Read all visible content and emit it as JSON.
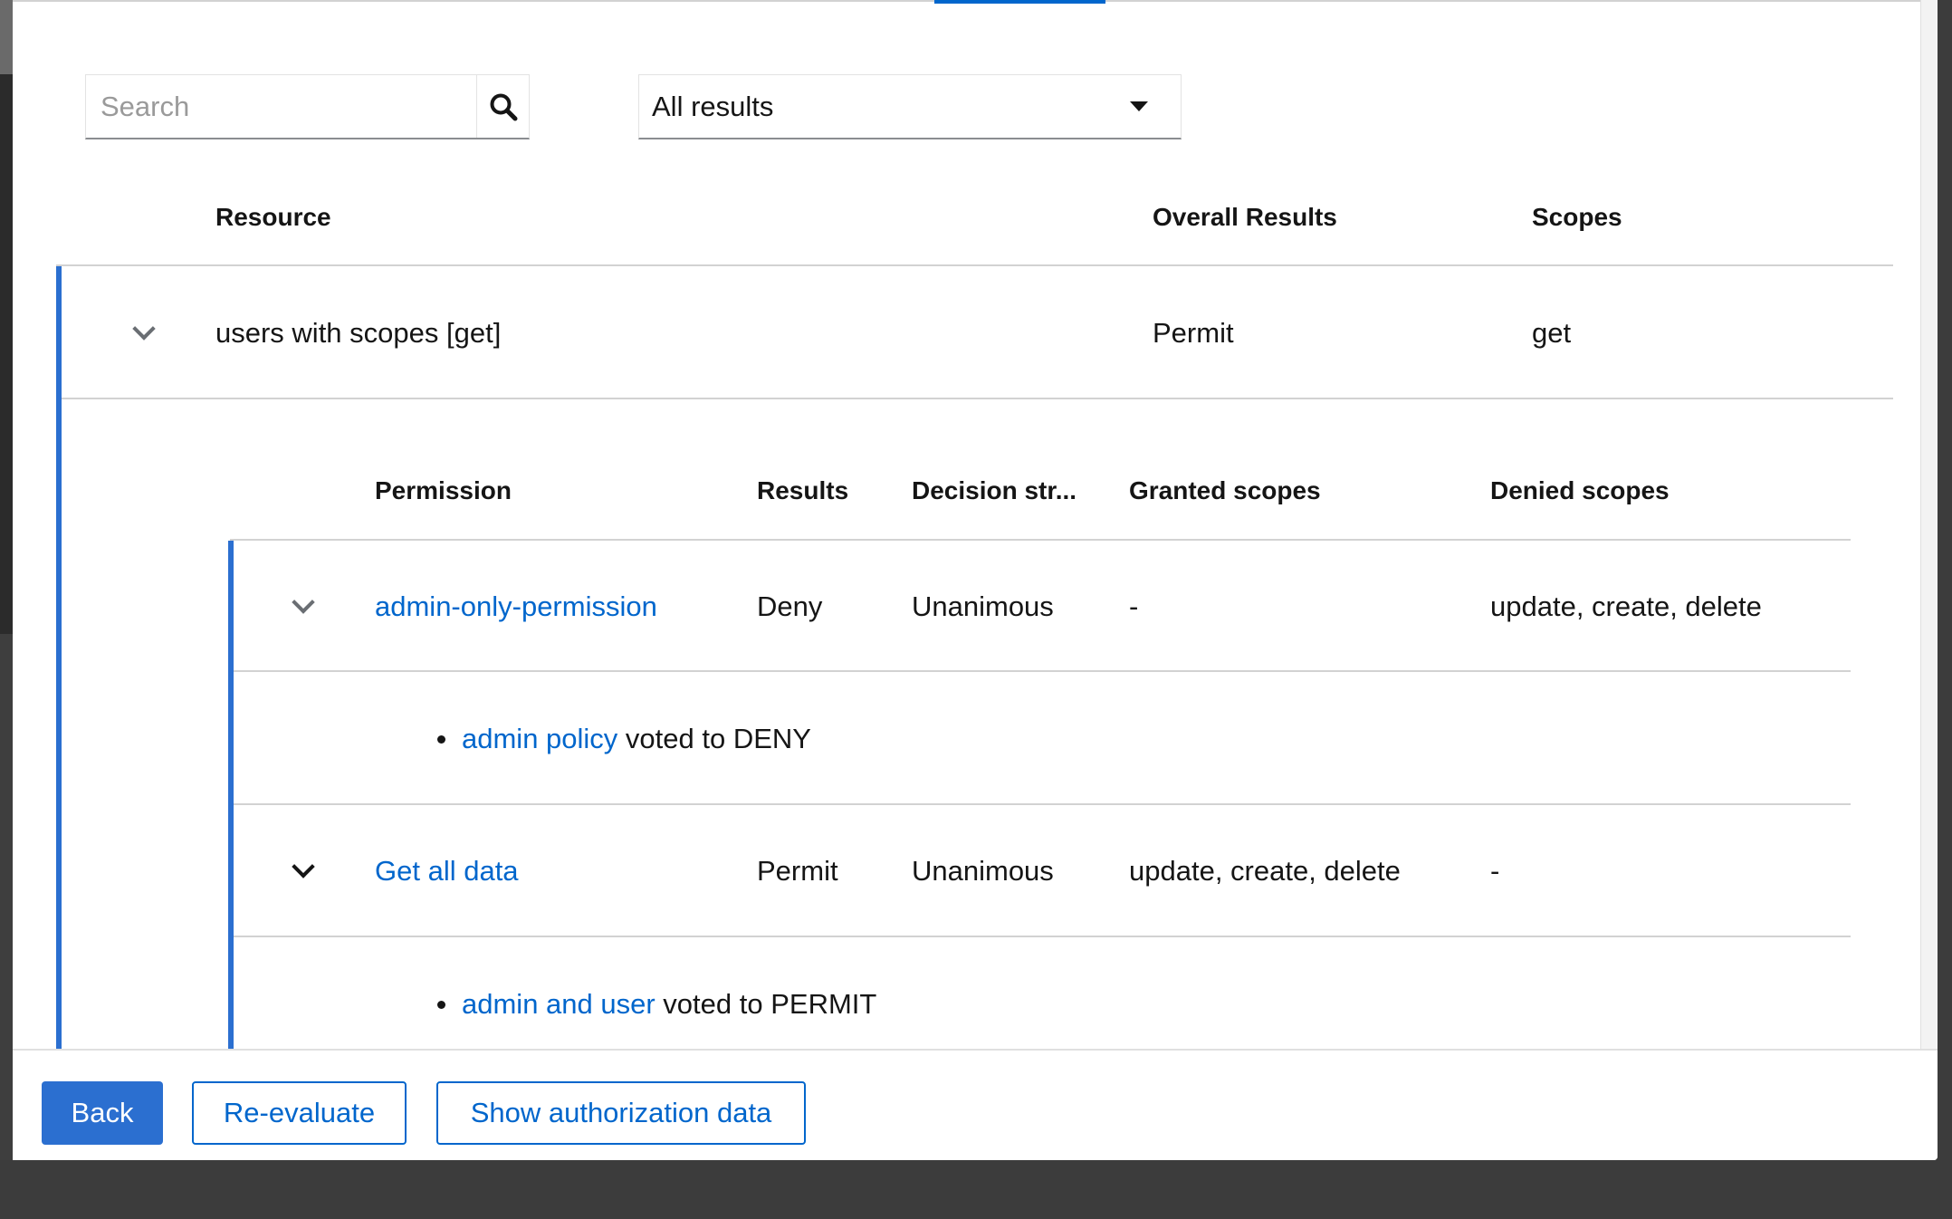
{
  "toolbar": {
    "search_placeholder": "Search",
    "filter_value": "All results"
  },
  "resources_table": {
    "headers": {
      "resource": "Resource",
      "overall": "Overall Results",
      "scopes": "Scopes"
    },
    "rows": [
      {
        "resource": "users with scopes [get]",
        "overall": "Permit",
        "scopes": "get",
        "expanded": true
      }
    ]
  },
  "permissions_table": {
    "headers": {
      "permission": "Permission",
      "results": "Results",
      "decision": "Decision str...",
      "granted": "Granted scopes",
      "denied": "Denied scopes"
    },
    "rows": [
      {
        "permission": "admin-only-permission",
        "results": "Deny",
        "decision": "Unanimous",
        "granted": "-",
        "denied": "update, create, delete",
        "policy_link": "admin policy",
        "policy_text": " voted to DENY"
      },
      {
        "permission": "Get all data",
        "results": "Permit",
        "decision": "Unanimous",
        "granted": "update, create, delete",
        "denied": "-",
        "policy_link": "admin and user",
        "policy_text": " voted to PERMIT"
      }
    ]
  },
  "footer": {
    "back": "Back",
    "reevaluate": "Re-evaluate",
    "show_auth": "Show authorization data"
  },
  "colors": {
    "accent": "#0066cc",
    "primary_button": "#2b6fd0"
  }
}
